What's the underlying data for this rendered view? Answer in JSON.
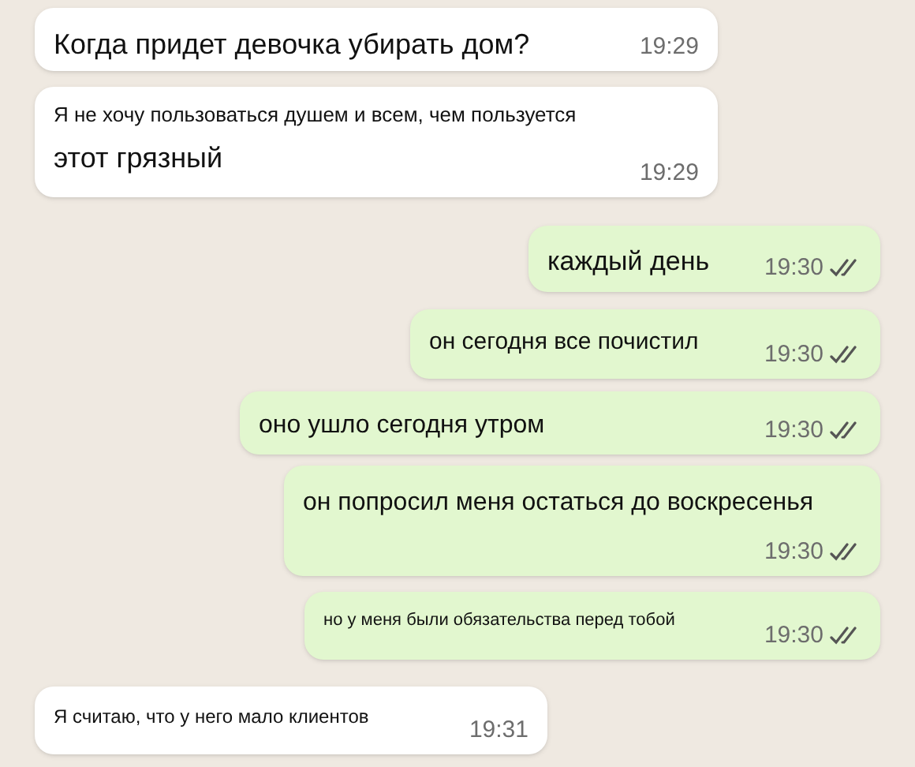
{
  "messages": [
    {
      "outgoing": false,
      "lines": [
        "Когда придет девочка убирать дом?"
      ],
      "time": "19:29"
    },
    {
      "outgoing": false,
      "lines": [
        "Я не хочу пользоваться душем и всем, чем пользуется",
        "этот грязный"
      ],
      "time": "19:29"
    },
    {
      "outgoing": true,
      "lines": [
        "каждый день"
      ],
      "time": "19:30",
      "delivered": true
    },
    {
      "outgoing": true,
      "lines": [
        "он сегодня все почистил"
      ],
      "time": "19:30",
      "delivered": true
    },
    {
      "outgoing": true,
      "lines": [
        "оно ушло сегодня утром"
      ],
      "time": "19:30",
      "delivered": true
    },
    {
      "outgoing": true,
      "lines": [
        "он попросил меня остаться до воскресенья"
      ],
      "time": "19:30",
      "delivered": true
    },
    {
      "outgoing": true,
      "lines": [
        "но у меня были обязательства перед тобой"
      ],
      "time": "19:30",
      "delivered": true
    },
    {
      "outgoing": false,
      "lines": [
        "Я считаю, что у него мало клиентов"
      ],
      "time": "19:31"
    }
  ]
}
